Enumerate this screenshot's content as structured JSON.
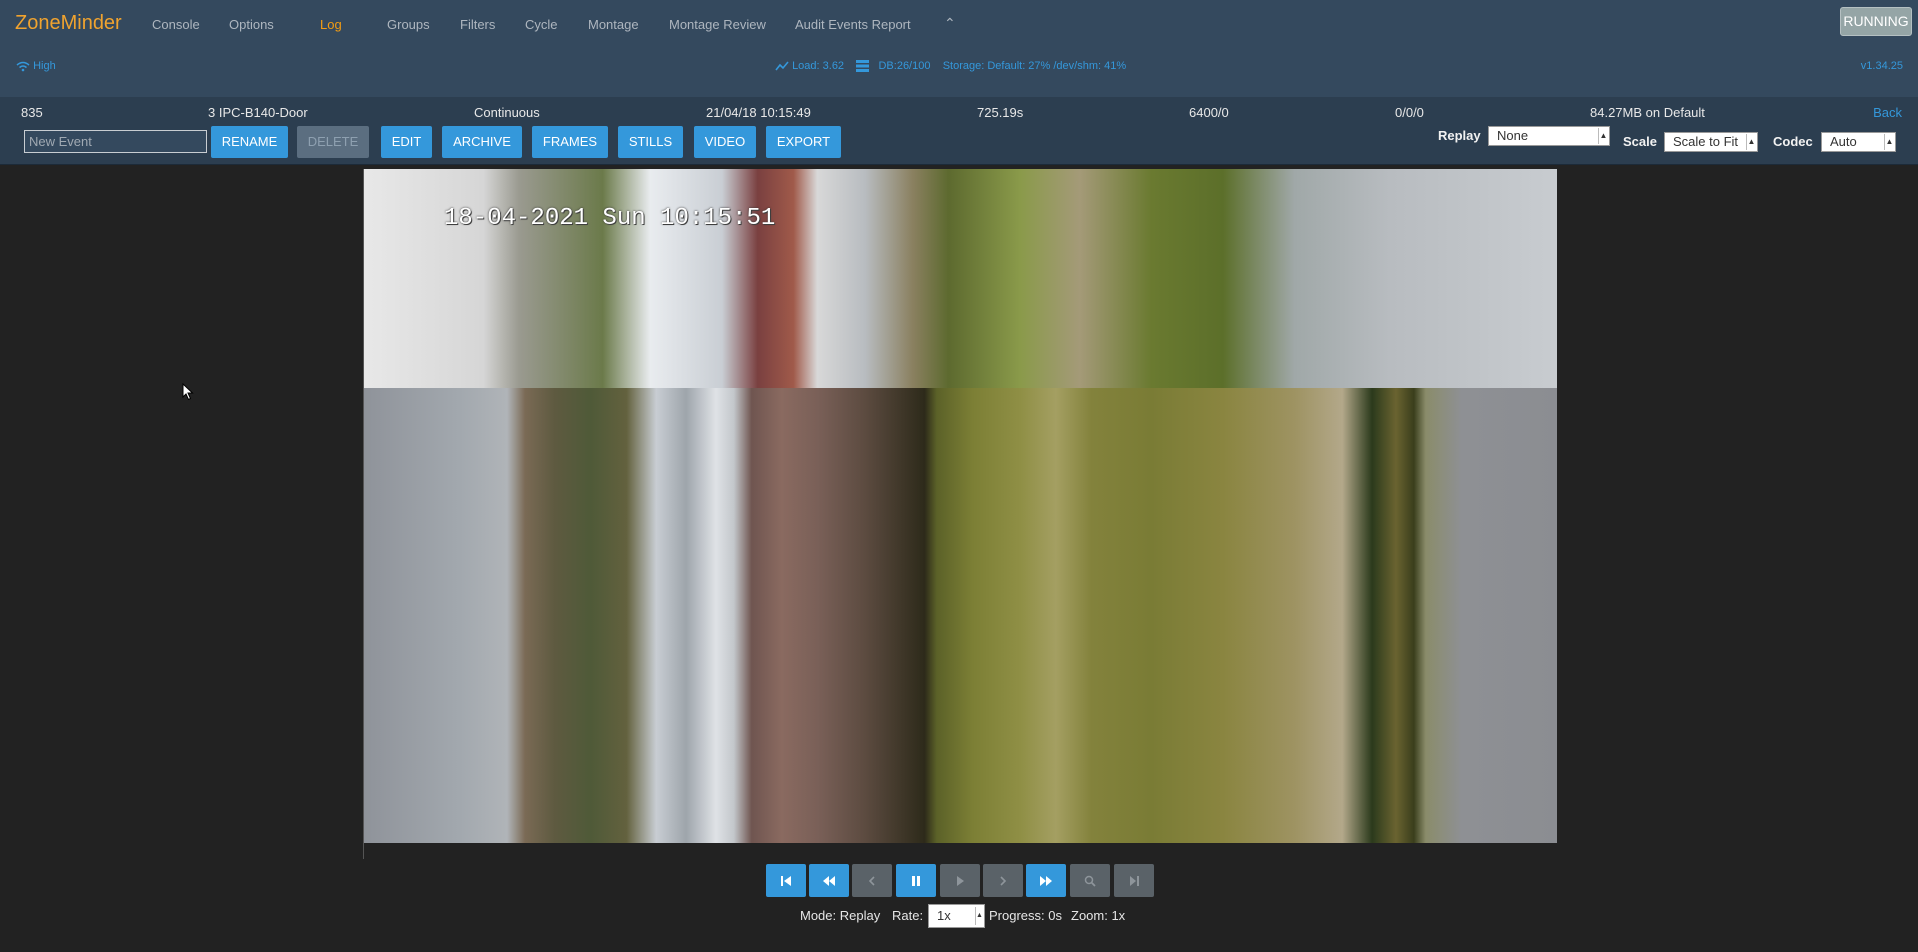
{
  "app": {
    "brand": "ZoneMinder",
    "state_button": "RUNNING",
    "version": "v1.34.25"
  },
  "nav": [
    "Console",
    "Options",
    "Log",
    "Groups",
    "Filters",
    "Cycle",
    "Montage",
    "Montage Review",
    "Audit Events Report"
  ],
  "nav_active": "Log",
  "status": {
    "bandwidth": "High",
    "load": "Load: 3.62",
    "db": "DB:26/100",
    "storage": "Storage: Default: 27% /dev/shm: 41%"
  },
  "event": {
    "id": "835",
    "monitor": "3 IPC-B140-Door",
    "cause": "Continuous",
    "time": "21/04/18 10:15:49",
    "duration": "725.19s",
    "frames": "6400/0",
    "score": "0/0/0",
    "disk": "84.27MB on Default",
    "back": "Back"
  },
  "actions": {
    "name_placeholder": "New Event",
    "buttons": [
      "RENAME",
      "DELETE",
      "EDIT",
      "ARCHIVE",
      "FRAMES",
      "STILLS",
      "VIDEO",
      "EXPORT"
    ]
  },
  "controls": {
    "replay_label": "Replay",
    "replay_value": "None",
    "scale_label": "Scale",
    "scale_value": "Scale to Fit",
    "codec_label": "Codec",
    "codec_value": "Auto"
  },
  "video": {
    "osd_timestamp": "18-04-2021 Sun 10:15:51"
  },
  "playback": {
    "buttons": [
      {
        "icon": "fast-backward-icon",
        "enabled": true
      },
      {
        "icon": "rewind-icon",
        "enabled": true
      },
      {
        "icon": "step-back-icon",
        "enabled": false
      },
      {
        "icon": "pause-icon",
        "enabled": true
      },
      {
        "icon": "play-icon",
        "enabled": false
      },
      {
        "icon": "step-forward-icon",
        "enabled": false
      },
      {
        "icon": "fast-forward-icon",
        "enabled": true
      },
      {
        "icon": "zoom-out-icon",
        "enabled": false
      },
      {
        "icon": "next-event-icon",
        "enabled": false
      }
    ],
    "mode": "Mode: Replay",
    "rate_label": "Rate:",
    "rate_value": "1x",
    "progress": "Progress: 0s",
    "zoom": "Zoom: 1x"
  }
}
